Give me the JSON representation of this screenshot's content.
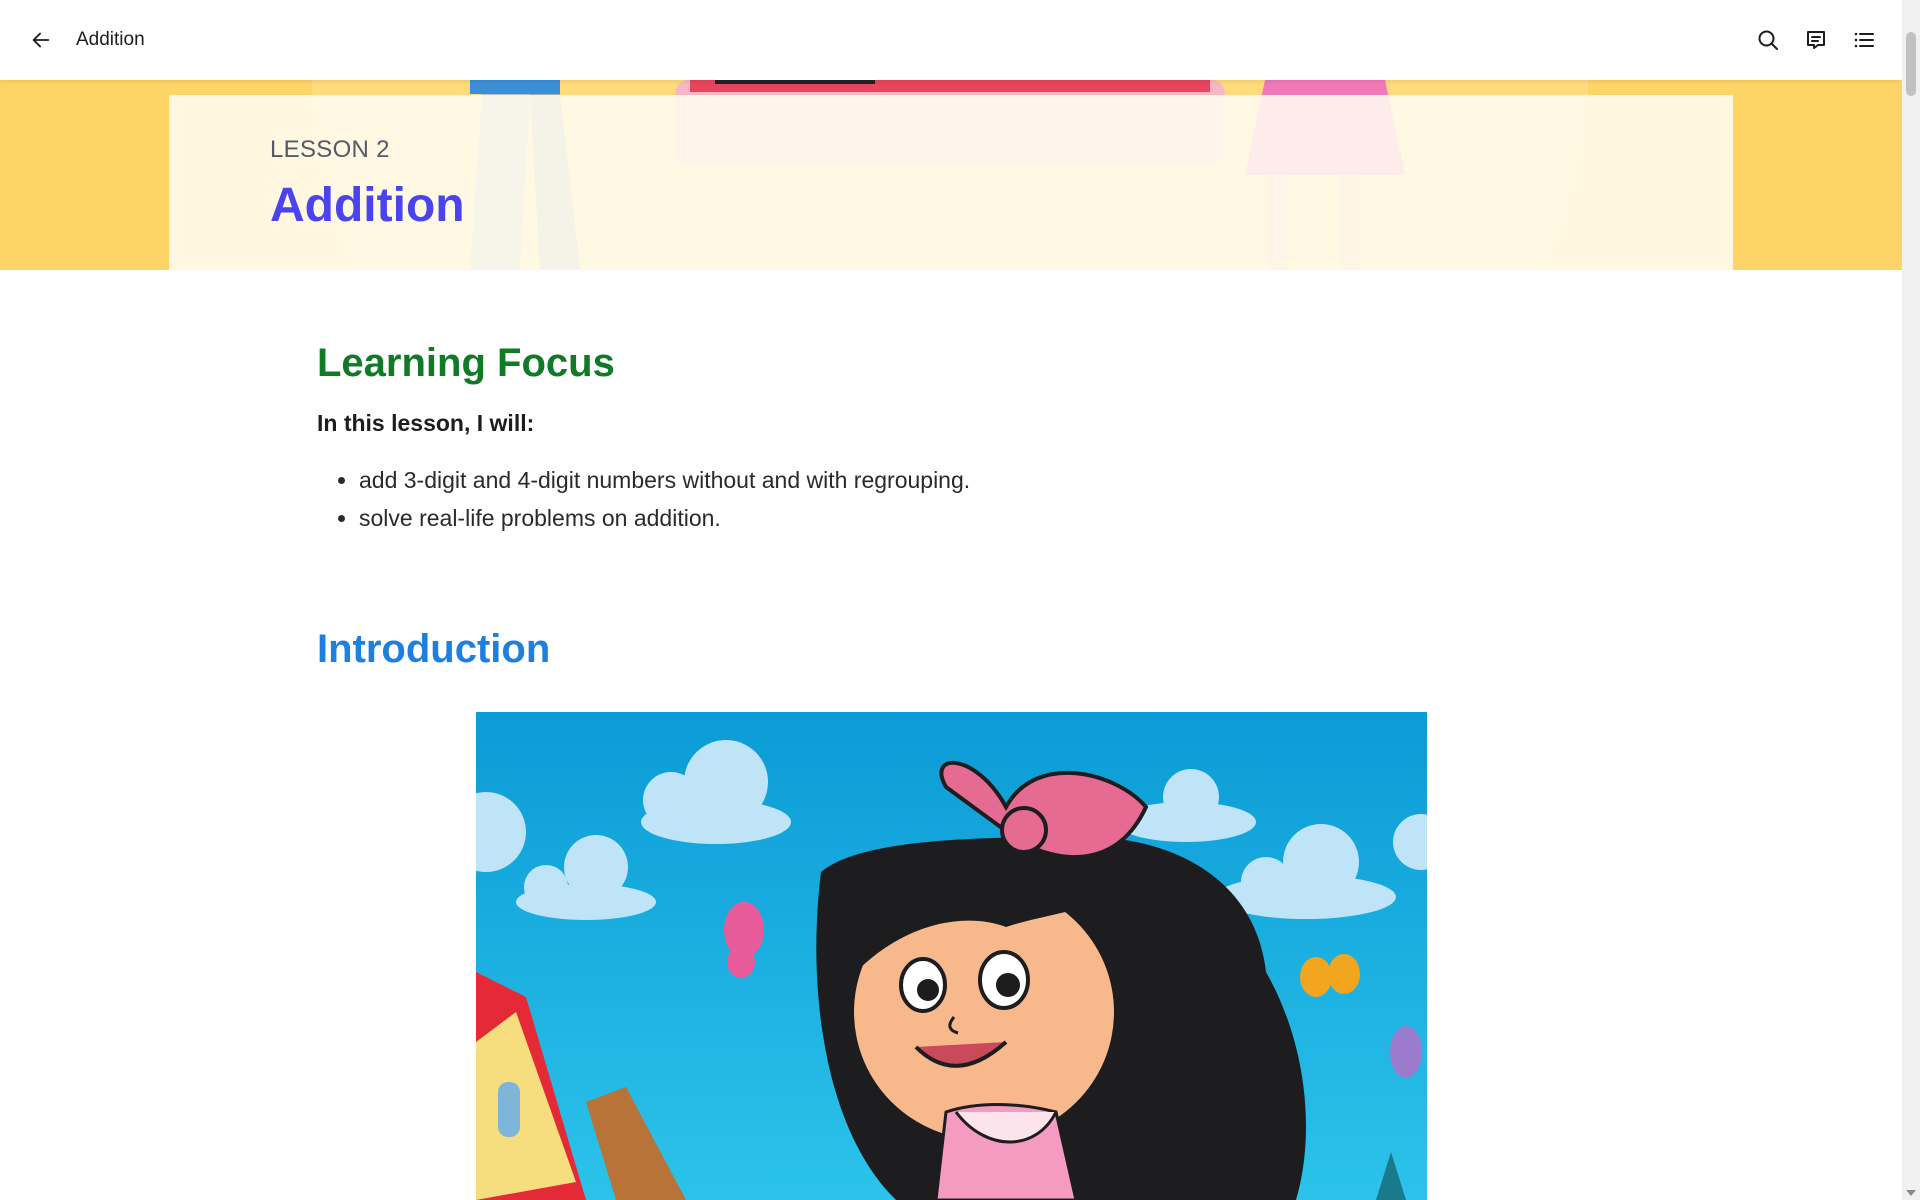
{
  "topbar": {
    "title": "Addition",
    "back_icon": "arrow-left-icon",
    "actions": [
      "search-icon",
      "notes-icon",
      "table-of-contents-icon"
    ]
  },
  "hero": {
    "lesson_label": "LESSON 2",
    "lesson_title": "Addition",
    "accent_color": "#4a44f0",
    "background_color": "#ffd466"
  },
  "learning_focus": {
    "heading": "Learning Focus",
    "lead": "In this lesson, I will:",
    "items": [
      "add 3-digit and 4-digit numbers without and with regrouping.",
      "solve real-life problems on addition."
    ],
    "color": "#117a26"
  },
  "introduction": {
    "heading": "Introduction",
    "color": "#1d7fe0",
    "image": "cartoon-girl-illustration"
  }
}
